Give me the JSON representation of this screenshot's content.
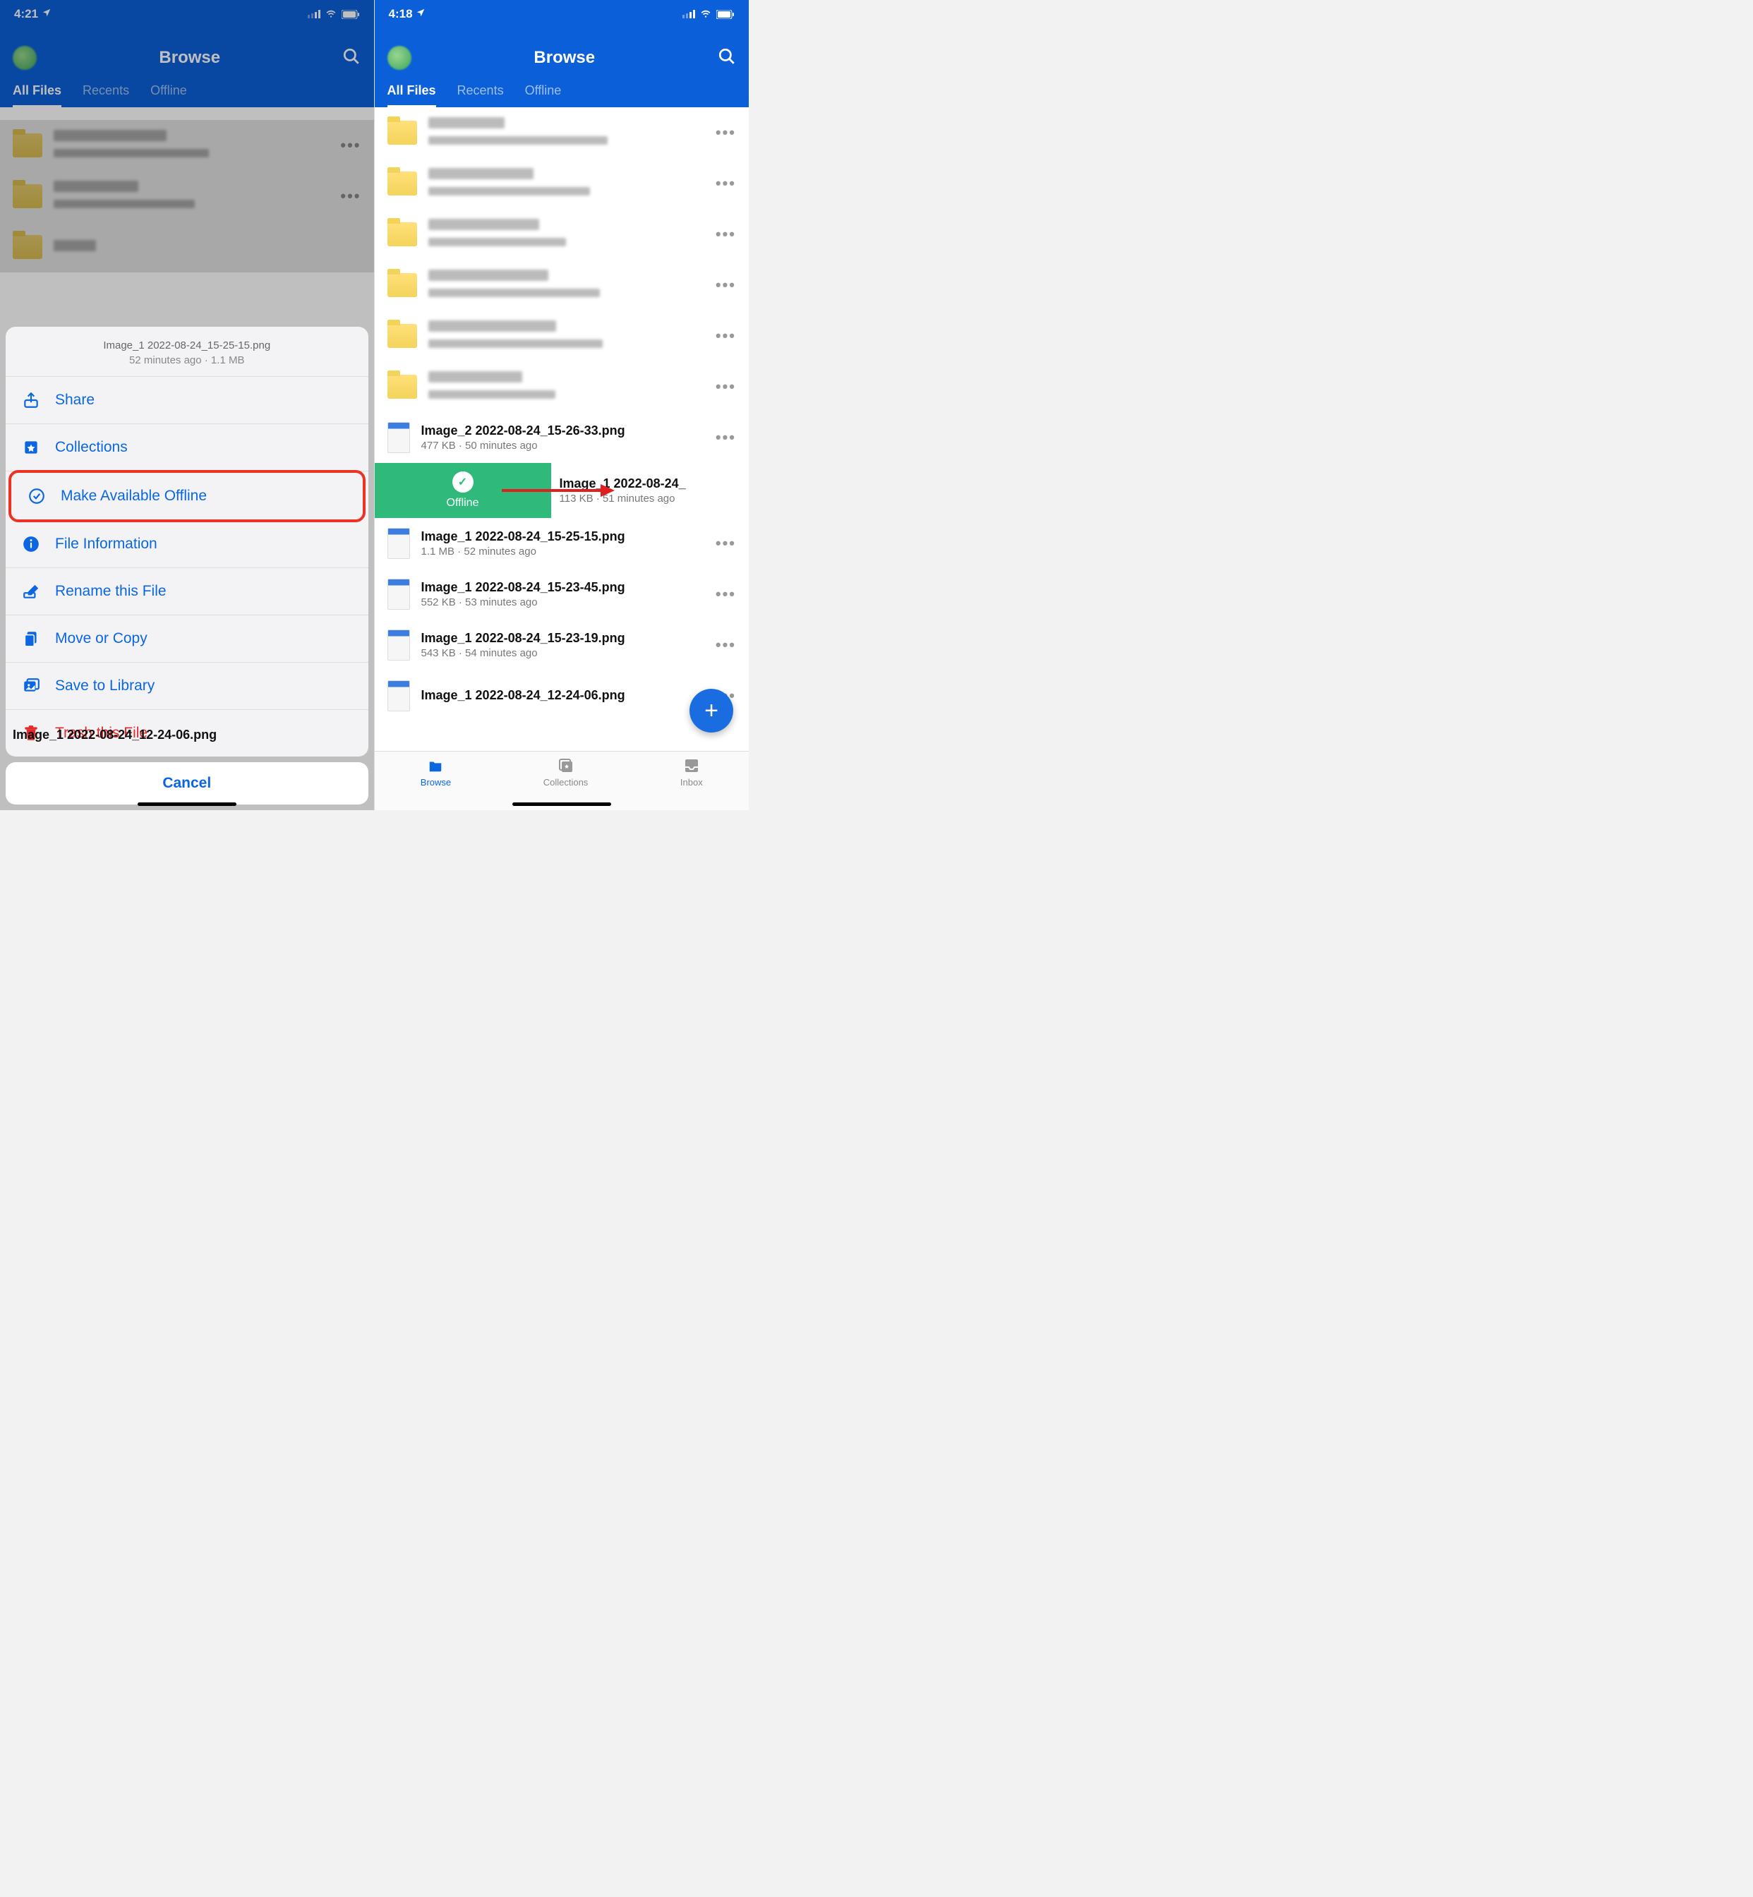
{
  "left": {
    "status_time": "4:21",
    "header_title": "Browse",
    "tabs": [
      "All Files",
      "Recents",
      "Offline"
    ],
    "active_tab": 0,
    "sheet": {
      "filename": "Image_1 2022-08-24_15-25-15.png",
      "meta": "52 minutes ago · 1.1 MB",
      "items": [
        {
          "icon": "share-icon",
          "label": "Share"
        },
        {
          "icon": "collections-icon",
          "label": "Collections"
        },
        {
          "icon": "offline-icon",
          "label": "Make Available Offline",
          "highlight": true
        },
        {
          "icon": "info-icon",
          "label": "File Information"
        },
        {
          "icon": "rename-icon",
          "label": "Rename this File"
        },
        {
          "icon": "move-icon",
          "label": "Move or Copy"
        },
        {
          "icon": "save-icon",
          "label": "Save to Library"
        },
        {
          "icon": "trash-icon",
          "label": "Trash this File",
          "danger": true
        }
      ],
      "cancel": "Cancel"
    },
    "peek_filename": "Image_1 2022-08-24_12-24-06.png"
  },
  "right": {
    "status_time": "4:18",
    "header_title": "Browse",
    "tabs": [
      "All Files",
      "Recents",
      "Offline"
    ],
    "active_tab": 0,
    "swipe_label": "Offline",
    "files": [
      {
        "type": "folder"
      },
      {
        "type": "folder"
      },
      {
        "type": "folder"
      },
      {
        "type": "folder"
      },
      {
        "type": "folder"
      },
      {
        "type": "folder"
      },
      {
        "type": "file",
        "title": "Image_2 2022-08-24_15-26-33.png",
        "sub": "477 KB · 50 minutes ago"
      },
      {
        "type": "swipe",
        "title": "Image_1 2022-08-24_",
        "sub": "113 KB · 51 minutes ago"
      },
      {
        "type": "file",
        "title": "Image_1 2022-08-24_15-25-15.png",
        "sub": "1.1 MB · 52 minutes ago"
      },
      {
        "type": "file",
        "title": "Image_1 2022-08-24_15-23-45.png",
        "sub": "552 KB · 53 minutes ago"
      },
      {
        "type": "file",
        "title": "Image_1 2022-08-24_15-23-19.png",
        "sub": "543 KB · 54 minutes ago"
      },
      {
        "type": "file",
        "title": "Image_1 2022-08-24_12-24-06.png",
        "sub": ""
      }
    ],
    "nav": [
      {
        "label": "Browse",
        "active": true
      },
      {
        "label": "Collections",
        "active": false
      },
      {
        "label": "Inbox",
        "active": false
      }
    ]
  }
}
